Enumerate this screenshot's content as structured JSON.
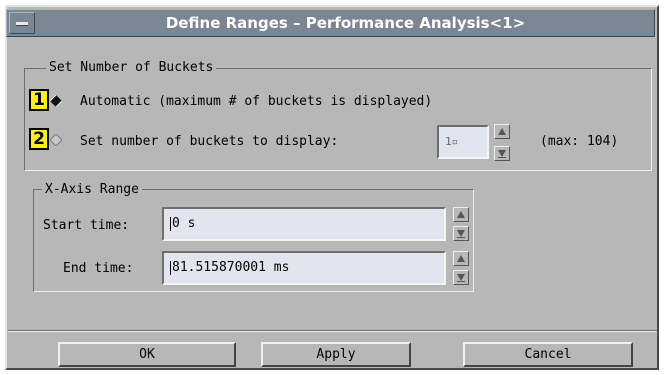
{
  "window": {
    "title": "Define Ranges – Performance Analysis<1>"
  },
  "buckets_group": {
    "legend": "Set Number of Buckets",
    "option1": {
      "badge": "1",
      "label": "Automatic (maximum # of buckets is displayed)",
      "selected": true
    },
    "option2": {
      "badge": "2",
      "label": "Set number of buckets to display:",
      "value": "1▫",
      "max_label": "(max: 104)",
      "selected": false
    }
  },
  "xaxis_group": {
    "legend": "X-Axis Range",
    "start_label": "Start time:",
    "start_value": "0 s",
    "end_label": "End time:",
    "end_value": "81.515870001 ms"
  },
  "buttons": {
    "ok": "OK",
    "apply": "Apply",
    "cancel": "Cancel"
  },
  "icons": {
    "menu": "window-menu-icon",
    "spin_up": "arrow-up-icon",
    "spin_down": "arrow-down-icon"
  },
  "colors": {
    "titlebar": "#7a8693",
    "dialog": "#b7b7b7",
    "field": "#e2e4ee",
    "badge": "#fff200"
  }
}
